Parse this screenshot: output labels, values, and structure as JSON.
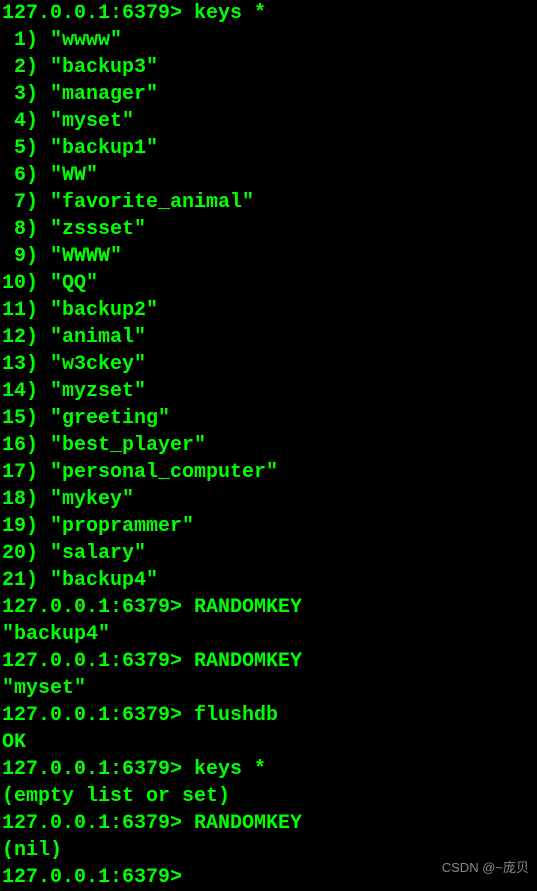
{
  "prompt": "127.0.0.1:6379>",
  "sessions": [
    {
      "command": "keys *",
      "output_type": "list",
      "items": [
        "\"wwww\"",
        "\"backup3\"",
        "\"manager\"",
        "\"myset\"",
        "\"backup1\"",
        "\"WW\"",
        "\"favorite_animal\"",
        "\"zssset\"",
        "\"WWWW\"",
        "\"QQ\"",
        "\"backup2\"",
        "\"animal\"",
        "\"w3ckey\"",
        "\"myzset\"",
        "\"greeting\"",
        "\"best_player\"",
        "\"personal_computer\"",
        "\"mykey\"",
        "\"proprammer\"",
        "\"salary\"",
        "\"backup4\""
      ]
    },
    {
      "command": "RANDOMKEY",
      "output_type": "single",
      "output": "\"backup4\""
    },
    {
      "command": "RANDOMKEY",
      "output_type": "single",
      "output": "\"myset\""
    },
    {
      "command": "flushdb",
      "output_type": "single",
      "output": "OK"
    },
    {
      "command": "keys *",
      "output_type": "single",
      "output": "(empty list or set)"
    },
    {
      "command": "RANDOMKEY",
      "output_type": "single",
      "output": "(nil)"
    },
    {
      "command": "",
      "output_type": "none"
    }
  ],
  "watermark": "CSDN @~庞贝"
}
